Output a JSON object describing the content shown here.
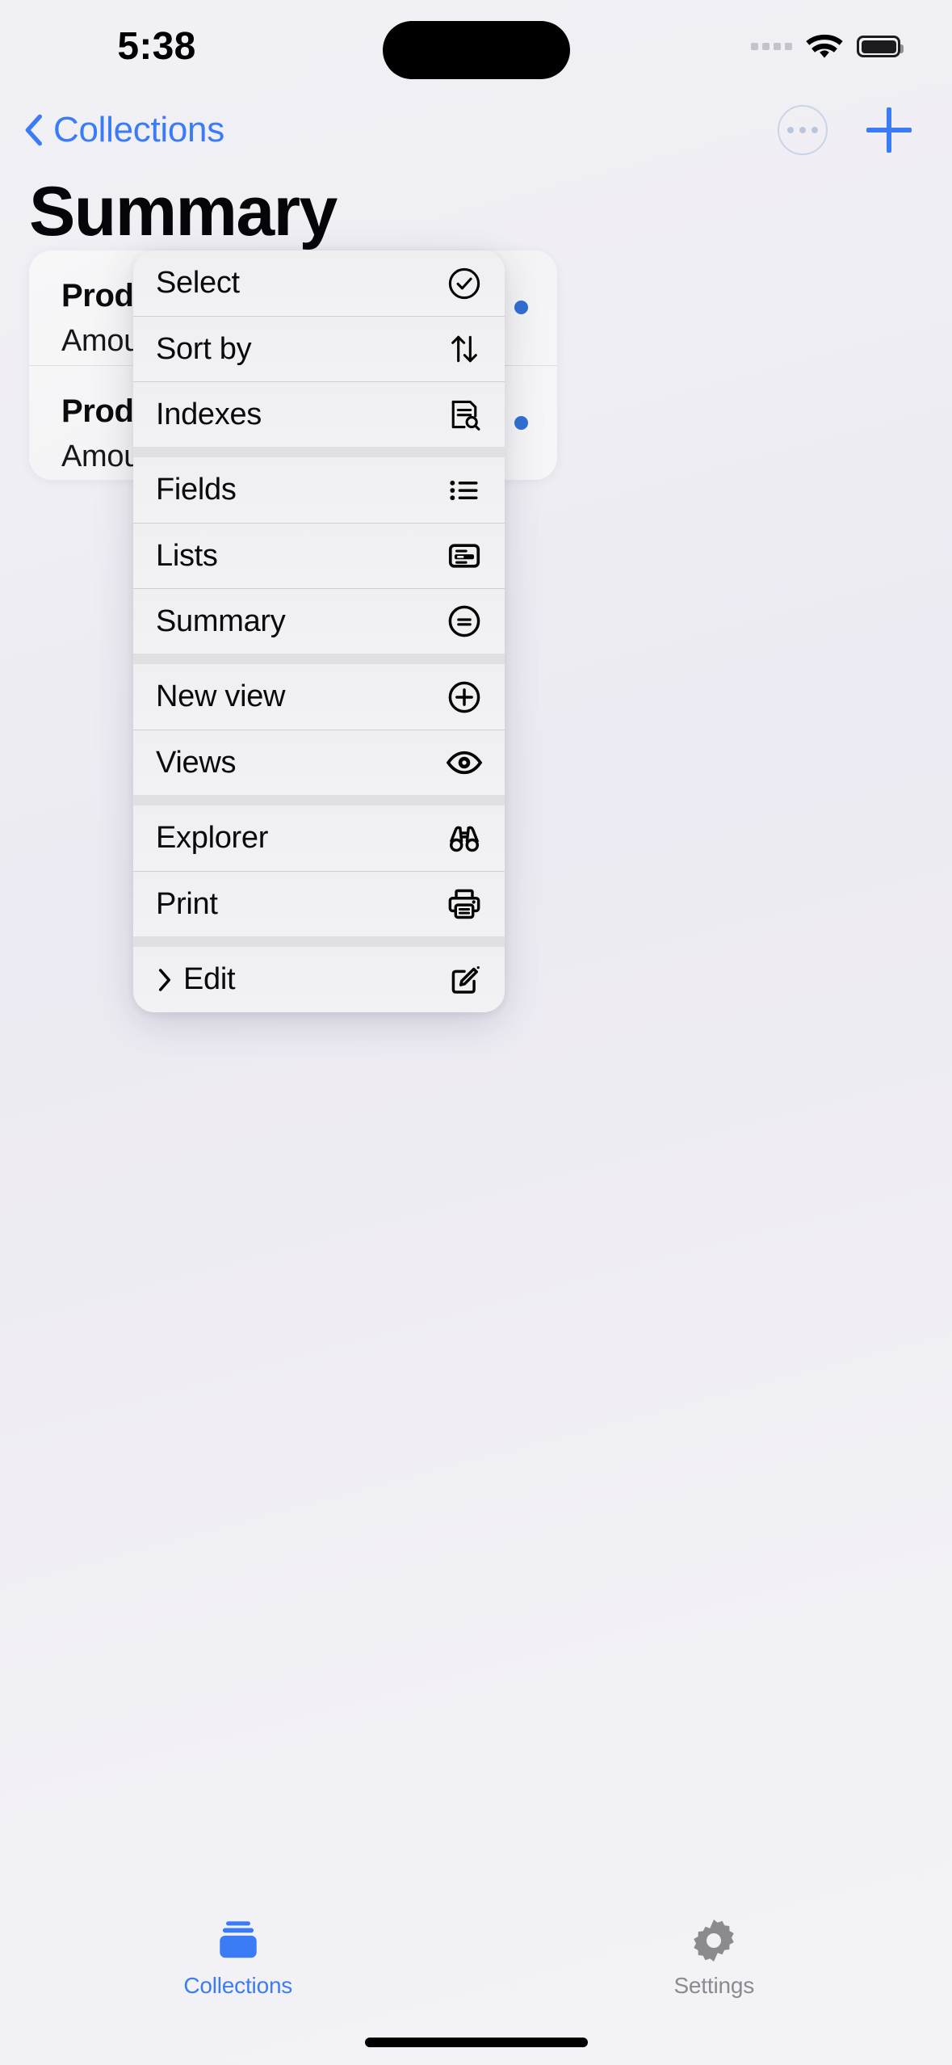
{
  "status_bar": {
    "time": "5:38",
    "cellular_icon": "cellular-dots-icon",
    "wifi_icon": "wifi-icon",
    "battery_icon": "battery-full-icon"
  },
  "nav_bar": {
    "back_label": "Collections",
    "back_icon": "chevron-left-icon",
    "more_button_icon": "ellipsis-circle-icon",
    "add_button_icon": "plus-icon"
  },
  "page": {
    "title": "Summary",
    "accent_color": "#3b7cf6",
    "dot_color": "#2f6fd4"
  },
  "content_card": {
    "rows": [
      {
        "title": "Product",
        "subtitle": "Amount",
        "badge_icon": "two-dots-icon"
      },
      {
        "title": "Product",
        "subtitle": "Amount",
        "badge_icon": "two-dots-icon"
      }
    ]
  },
  "context_menu": {
    "groups": [
      {
        "items": [
          {
            "label": "Select",
            "icon": "checkmark-circle-icon",
            "submenu": false
          },
          {
            "label": "Sort by",
            "icon": "arrow-up-arrow-down-icon",
            "submenu": false
          },
          {
            "label": "Indexes",
            "icon": "document-magnifier-icon",
            "submenu": false
          }
        ]
      },
      {
        "items": [
          {
            "label": "Fields",
            "icon": "bullet-list-icon",
            "submenu": false
          },
          {
            "label": "Lists",
            "icon": "list-card-icon",
            "submenu": false
          },
          {
            "label": "Summary",
            "icon": "equals-circle-icon",
            "submenu": false
          }
        ]
      },
      {
        "items": [
          {
            "label": "New view",
            "icon": "plus-circle-icon",
            "submenu": false
          },
          {
            "label": "Views",
            "icon": "eye-icon",
            "submenu": false
          }
        ]
      },
      {
        "items": [
          {
            "label": "Explorer",
            "icon": "binoculars-icon",
            "submenu": false
          },
          {
            "label": "Print",
            "icon": "printer-icon",
            "submenu": false
          }
        ]
      },
      {
        "items": [
          {
            "label": "Edit",
            "icon": "square-pencil-icon",
            "submenu": true,
            "submenu_icon": "chevron-right-icon"
          }
        ]
      }
    ]
  },
  "tab_bar": {
    "tabs": [
      {
        "label": "Collections",
        "icon": "collections-stack-icon",
        "active": true
      },
      {
        "label": "Settings",
        "icon": "gear-icon",
        "active": false
      }
    ]
  }
}
